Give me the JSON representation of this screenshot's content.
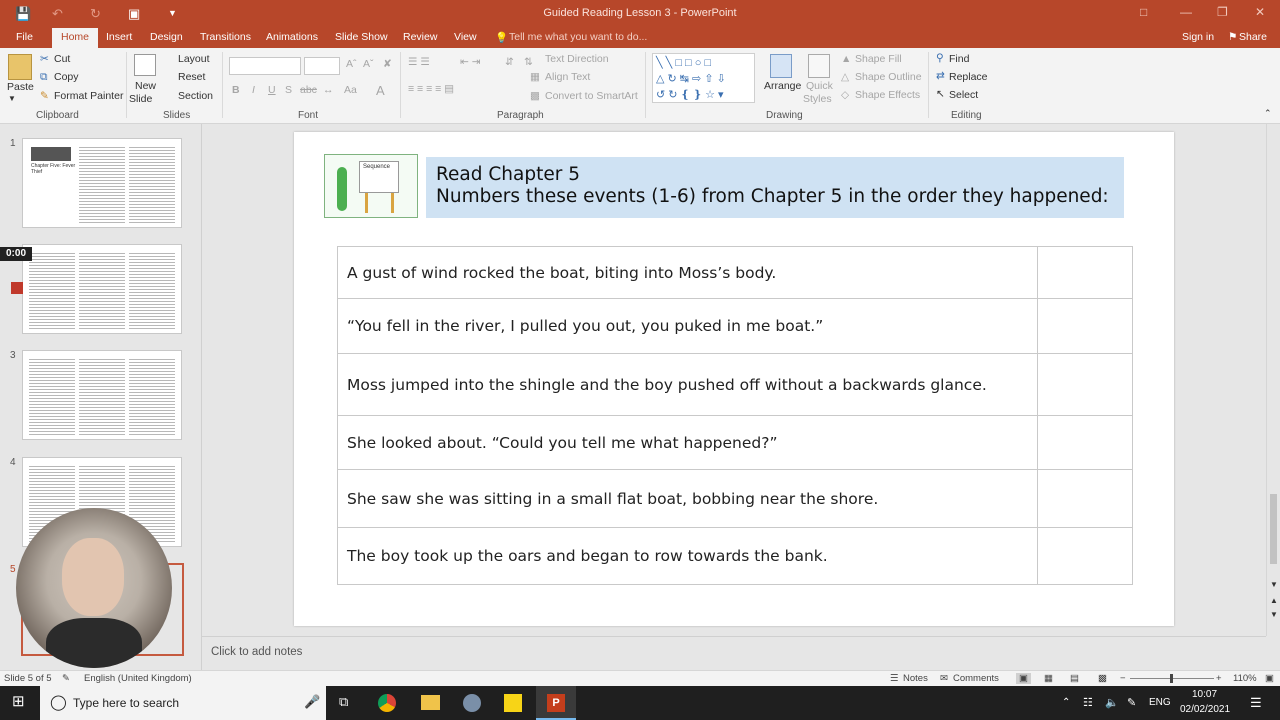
{
  "app": {
    "title": "Guided Reading Lesson 3 - PowerPoint",
    "signin": "Sign in",
    "share": "Share"
  },
  "tabs": [
    "File",
    "Home",
    "Insert",
    "Design",
    "Transitions",
    "Animations",
    "Slide Show",
    "Review",
    "View"
  ],
  "tell_me": "Tell me what you want to do...",
  "ribbon": {
    "clipboard": {
      "paste": "Paste",
      "cut": "Cut",
      "copy": "Copy",
      "format_painter": "Format Painter",
      "label": "Clipboard"
    },
    "slides": {
      "new_slide_1": "New",
      "new_slide_2": "Slide",
      "layout": "Layout",
      "reset": "Reset",
      "section": "Section",
      "label": "Slides"
    },
    "font": {
      "label": "Font",
      "bold": "B",
      "italic": "I",
      "underline": "U",
      "strike": "S",
      "spacing": "abc"
    },
    "paragraph": {
      "text_direction": "Text Direction",
      "align_text": "Align Text",
      "convert_smartart": "Convert to SmartArt",
      "label": "Paragraph"
    },
    "drawing": {
      "arrange": "Arrange",
      "quick_styles_1": "Quick",
      "quick_styles_2": "Styles",
      "shape_fill": "Shape Fill",
      "shape_outline": "Shape Outline",
      "shape_effects": "Shape Effects",
      "label": "Drawing"
    },
    "editing": {
      "find": "Find",
      "replace": "Replace",
      "select": "Select",
      "label": "Editing"
    }
  },
  "thumbnails": {
    "numbers": [
      "1",
      "2",
      "3",
      "4",
      "5"
    ],
    "thumb1_title": "Chapter Five: Fever Thief",
    "recording_time": "0:00"
  },
  "slide": {
    "banner_line1": "Read Chapter 5",
    "banner_line2": "Numbers these events (1-6) from Chapter 5 in the order they happened:",
    "image_label": "Sequence",
    "rows": [
      "A gust of wind rocked the boat, biting into Moss’s body.",
      "“You fell in the river, I pulled you out, you puked in me boat.”",
      "Moss jumped into the shingle and the boy pushed off without a backwards glance.",
      "She looked about. “Could you tell me what happened?”",
      "She saw she was sitting in a small flat boat, bobbing near the shore.",
      "The boy took up the oars and began to row towards the bank."
    ]
  },
  "notes_placeholder": "Click to add notes",
  "status": {
    "slide_of": "Slide 5 of 5",
    "language": "English (United Kingdom)",
    "notes": "Notes",
    "comments": "Comments",
    "zoom": "110%"
  },
  "taskbar": {
    "search_placeholder": "Type here to search",
    "lang": "ENG",
    "time": "10:07",
    "date": "02/02/2021"
  },
  "colors": {
    "accent": "#b7472a",
    "banner": "#cfe2f3",
    "ribbon": "#f3f3f3"
  }
}
